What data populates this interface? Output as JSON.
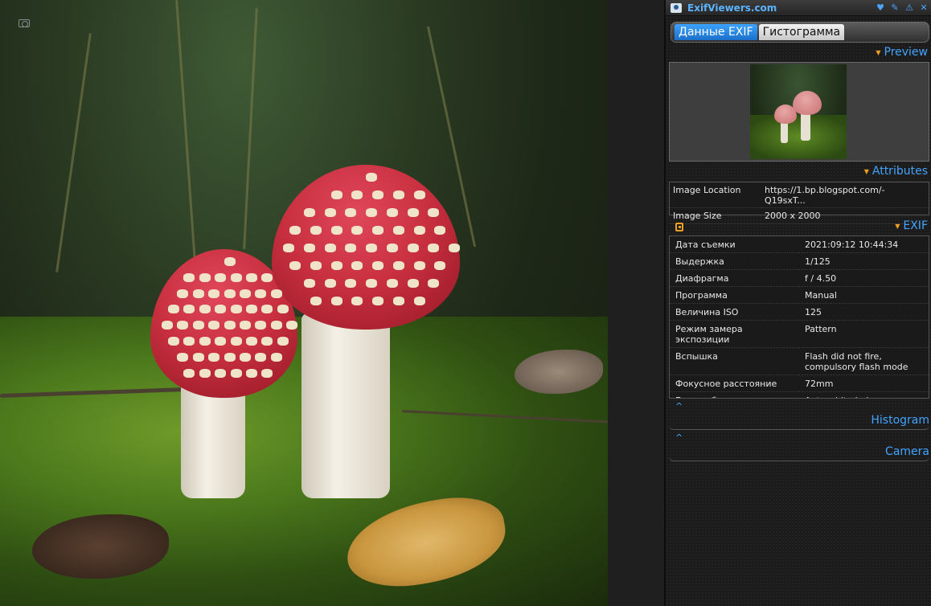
{
  "app": {
    "title": "ExifViewers.com",
    "icons": [
      "heart-icon",
      "wrench-icon",
      "warning-icon",
      "close-icon"
    ]
  },
  "tabs": [
    {
      "label": "Данные EXIF",
      "active": true
    },
    {
      "label": "Гистограмма",
      "active": false
    }
  ],
  "sections": {
    "preview": "Preview",
    "attributes": "Attributes",
    "exif": "EXIF",
    "histogram": "Histogram",
    "camera": "Camera"
  },
  "attributes": [
    {
      "key": "Image Location",
      "value": "https://1.bp.blogspot.com/-Q19sxT..."
    },
    {
      "key": "Image Size",
      "value": "2000 x 2000"
    }
  ],
  "exif": [
    {
      "key": "Дата съемки",
      "value": "2021:09:12 10:44:34"
    },
    {
      "key": "Выдержка",
      "value": "1/125"
    },
    {
      "key": "Диафрагма",
      "value": "f / 4.50"
    },
    {
      "key": "Программа",
      "value": "Manual"
    },
    {
      "key": "Величина ISO",
      "value": "125"
    },
    {
      "key": "Режим замера экспозиции",
      "value": "Pattern"
    },
    {
      "key": "Вспышка",
      "value": "Flash did not fire, compulsory flash mode"
    },
    {
      "key": "Фокусное расстояние",
      "value": "72mm"
    },
    {
      "key": "Баланс белого",
      "value": "Auto white balance"
    }
  ],
  "colors": {
    "accent": "#42a4ff",
    "tab_active": "#1b6fc8",
    "triangle": "#f0a020",
    "panel_bg": "#1b1b1b"
  }
}
